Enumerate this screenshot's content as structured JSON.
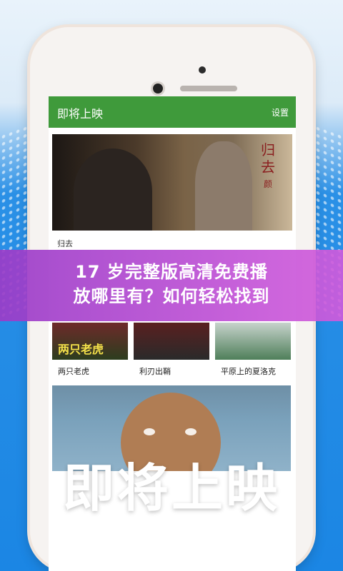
{
  "app": {
    "title": "即将上映",
    "settings_label": "设置"
  },
  "featured": {
    "caption": "归去",
    "poster_text": [
      "归",
      "去",
      "颜"
    ]
  },
  "banner": {
    "line1": "17 岁完整版高清免费播",
    "line2": "放哪里有？如何轻松找到"
  },
  "grid": {
    "items": [
      {
        "title": "两只老虎",
        "logo": "两只老虎"
      },
      {
        "title": "利刃出鞘",
        "logo": ""
      },
      {
        "title": "平原上的夏洛克",
        "logo": ""
      }
    ]
  },
  "bottom_title": "即将上映",
  "colors": {
    "appbar": "#3f9a3b",
    "background": "#1b8ae8",
    "banner": "#b94fd6"
  }
}
